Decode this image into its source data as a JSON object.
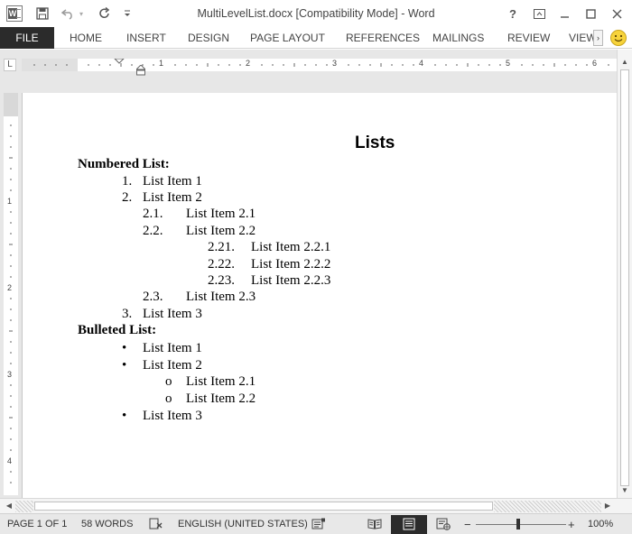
{
  "window": {
    "title": "MultiLevelList.docx [Compatibility Mode] - Word",
    "buttons": [
      "?",
      "minimize",
      "maximize",
      "close"
    ]
  },
  "quick_access": {
    "icons": [
      "word-app-icon",
      "save-icon",
      "undo-icon",
      "redo-icon",
      "customize-icon"
    ]
  },
  "ribbon": {
    "file_label": "FILE",
    "tabs": [
      "HOME",
      "INSERT",
      "DESIGN",
      "PAGE LAYOUT",
      "REFERENCES",
      "MAILINGS",
      "REVIEW",
      "VIEW"
    ],
    "scroll_glyph": "›"
  },
  "ruler": {
    "corner_glyph": "L",
    "numbers": [
      "1",
      "2",
      "3",
      "4",
      "5",
      "6"
    ],
    "vertical_numbers": [
      "1",
      "2",
      "3",
      "4"
    ]
  },
  "document": {
    "title": "Lists",
    "numbered_heading": "Numbered List:",
    "numbered_items": [
      {
        "marker": "1.",
        "text": "List Item 1"
      },
      {
        "marker": "2.",
        "text": "List Item 2"
      },
      {
        "marker": "2.1.",
        "text": "List Item 2.1"
      },
      {
        "marker": "2.2.",
        "text": "List Item 2.2"
      },
      {
        "marker": "2.21.",
        "text": "List Item 2.2.1"
      },
      {
        "marker": "2.22.",
        "text": "List Item 2.2.2"
      },
      {
        "marker": "2.23.",
        "text": "List Item 2.2.3"
      },
      {
        "marker": "2.3.",
        "text": "List Item 2.3"
      },
      {
        "marker": "3.",
        "text": "List Item 3"
      }
    ],
    "bulleted_heading": "Bulleted List:",
    "bulleted_items": [
      {
        "marker": "•",
        "text": "List Item 1"
      },
      {
        "marker": "•",
        "text": "List Item 2"
      },
      {
        "marker": "o",
        "text": "List Item 2.1"
      },
      {
        "marker": "o",
        "text": "List Item 2.2"
      },
      {
        "marker": "•",
        "text": "List Item 3"
      }
    ]
  },
  "statusbar": {
    "page": "PAGE 1 OF 1",
    "words": "58 WORDS",
    "language": "ENGLISH (UNITED STATES)",
    "zoom_minus": "−",
    "zoom_plus": "+",
    "zoom": "100%"
  }
}
